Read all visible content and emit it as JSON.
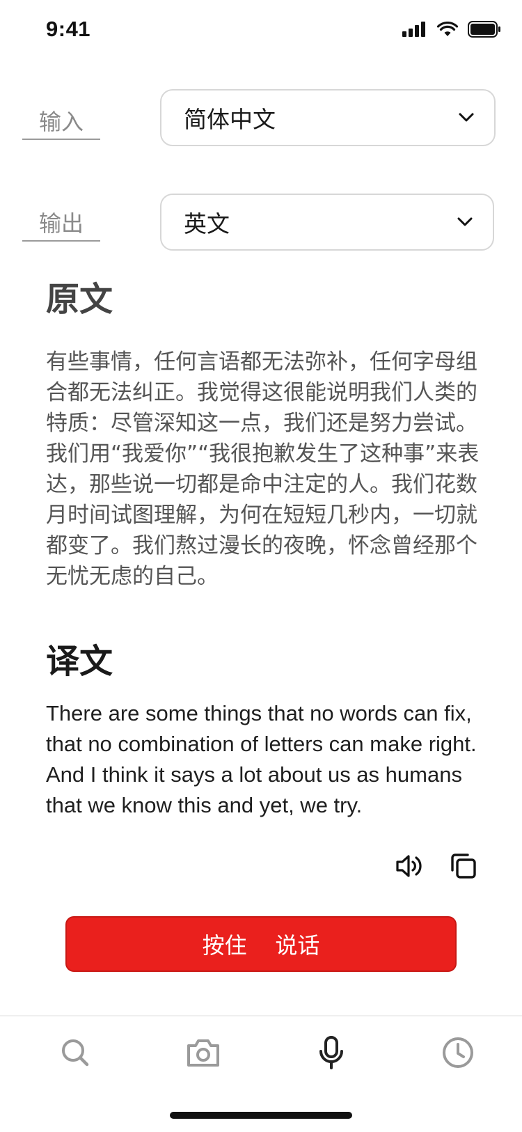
{
  "status": {
    "time": "9:41"
  },
  "input": {
    "label": "输入",
    "value": "简体中文"
  },
  "output": {
    "label": "输出",
    "value": "英文"
  },
  "source": {
    "title": "原文",
    "text": "有些事情，任何言语都无法弥补，任何字母组合都无法纠正。我觉得这很能说明我们人类的特质：尽管深知这一点，我们还是努力尝试。我们用“我爱你”“我很抱歉发生了这种事”来表达，那些说一切都是命中注定的人。我们花数月时间试图理解，为何在短短几秒内，一切就都变了。我们熬过漫长的夜晚，怀念曾经那个无忧无虑的自己。"
  },
  "translation": {
    "title": "译文",
    "text": "There are some things that no words can fix, that no combination of letters can make right. And I think it says a lot about us as humans that we know this and yet, we try."
  },
  "actions": {
    "speak_icon": "speaker-icon",
    "copy_icon": "copy-icon"
  },
  "talk_button": {
    "label": "按住    说话"
  },
  "tabs": [
    {
      "icon": "search-icon"
    },
    {
      "icon": "camera-icon"
    },
    {
      "icon": "microphone-icon"
    },
    {
      "icon": "clock-icon"
    }
  ],
  "colors": {
    "accent": "#ea201d",
    "muted": "#8a8a8a",
    "icon": "#9a9a9a",
    "active_icon": "#222222"
  }
}
